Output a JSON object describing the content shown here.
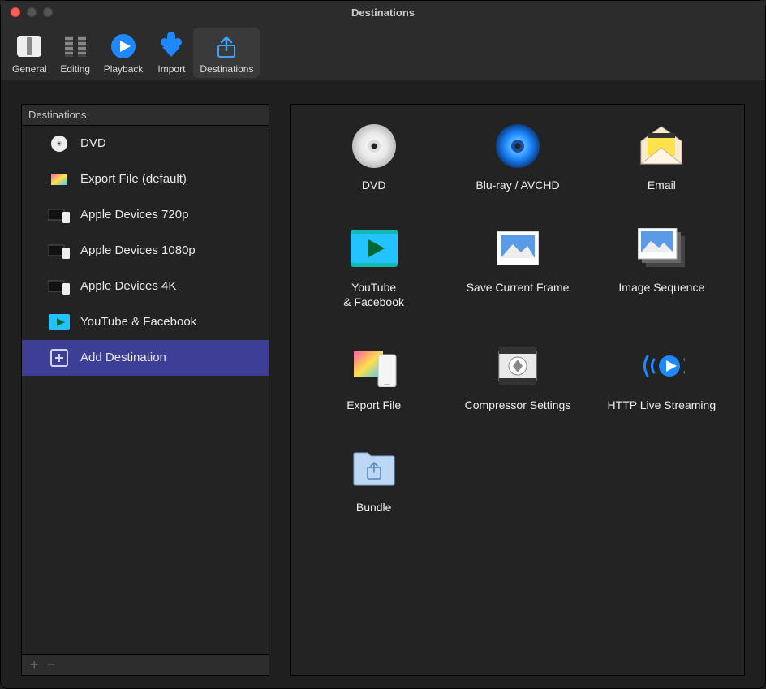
{
  "window": {
    "title": "Destinations"
  },
  "toolbar": {
    "items": [
      {
        "id": "tab-general",
        "label": "General",
        "active": false
      },
      {
        "id": "tab-editing",
        "label": "Editing",
        "active": false
      },
      {
        "id": "tab-playback",
        "label": "Playback",
        "active": false
      },
      {
        "id": "tab-import",
        "label": "Import",
        "active": false
      },
      {
        "id": "tab-destinations",
        "label": "Destinations",
        "active": true
      }
    ]
  },
  "sidebar": {
    "header": "Destinations",
    "items": [
      {
        "id": "dest-dvd",
        "label": "DVD",
        "icon": "dvd-icon",
        "selected": false
      },
      {
        "id": "dest-export-file",
        "label": "Export File (default)",
        "icon": "filmstrip-icon",
        "selected": false
      },
      {
        "id": "dest-apple-720p",
        "label": "Apple Devices 720p",
        "icon": "apple-devices-icon",
        "selected": false
      },
      {
        "id": "dest-apple-1080p",
        "label": "Apple Devices 1080p",
        "icon": "apple-devices-icon",
        "selected": false
      },
      {
        "id": "dest-apple-4k",
        "label": "Apple Devices 4K",
        "icon": "apple-devices-icon",
        "selected": false
      },
      {
        "id": "dest-youtube-fb",
        "label": "YouTube & Facebook",
        "icon": "youtube-icon",
        "selected": false
      },
      {
        "id": "dest-add",
        "label": "Add Destination",
        "icon": "add-icon",
        "selected": true
      }
    ],
    "footer": {
      "plus": "+",
      "minus": "−"
    }
  },
  "grid": {
    "items": [
      {
        "id": "card-dvd",
        "label": "DVD",
        "icon": "dvd-large-icon"
      },
      {
        "id": "card-bluray",
        "label": "Blu-ray / AVCHD",
        "icon": "bluray-icon"
      },
      {
        "id": "card-email",
        "label": "Email",
        "icon": "email-icon"
      },
      {
        "id": "card-youtube-fb",
        "label": "YouTube\n& Facebook",
        "icon": "youtube-large-icon"
      },
      {
        "id": "card-save-frame",
        "label": "Save Current Frame",
        "icon": "save-frame-icon"
      },
      {
        "id": "card-image-seq",
        "label": "Image Sequence",
        "icon": "image-sequence-icon"
      },
      {
        "id": "card-export-file",
        "label": "Export File",
        "icon": "export-file-icon"
      },
      {
        "id": "card-compressor",
        "label": "Compressor Settings",
        "icon": "compressor-icon"
      },
      {
        "id": "card-hls",
        "label": "HTTP Live Streaming",
        "icon": "hls-icon"
      },
      {
        "id": "card-bundle",
        "label": "Bundle",
        "icon": "bundle-icon"
      }
    ]
  },
  "colors": {
    "selection": "#3d3f97",
    "accent_blue": "#1e88ff",
    "accent_cyan": "#22c3ff"
  }
}
